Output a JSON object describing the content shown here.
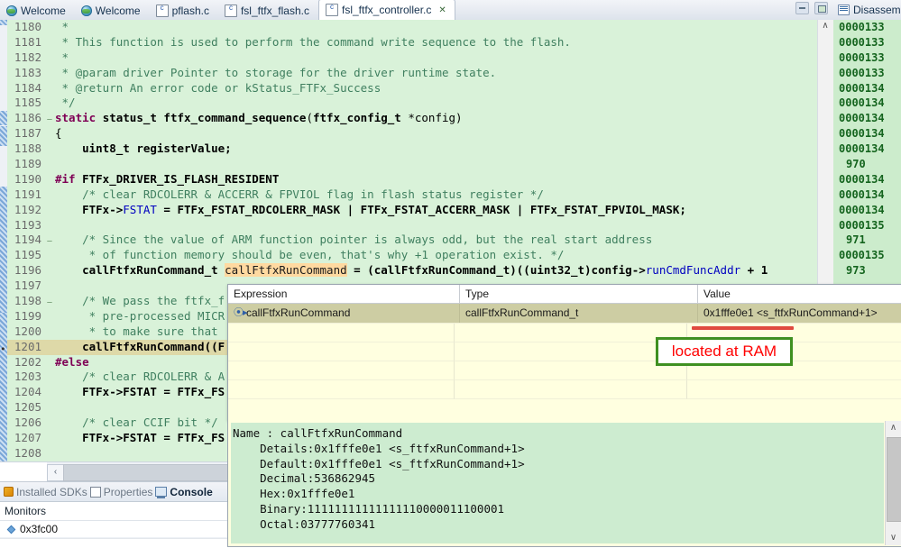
{
  "window": {
    "minimize_label": "minimize",
    "maximize_label": "maximize"
  },
  "editor_tabs": [
    {
      "label": "Welcome",
      "icon": "globe-icon",
      "active": false,
      "closeable": false
    },
    {
      "label": "Welcome",
      "icon": "globe-icon",
      "active": false,
      "closeable": false
    },
    {
      "label": "pflash.c",
      "icon": "c-file-icon",
      "active": false,
      "closeable": false
    },
    {
      "label": "fsl_ftfx_flash.c",
      "icon": "c-file-icon",
      "active": false,
      "closeable": false
    },
    {
      "label": "fsl_ftfx_controller.c",
      "icon": "c-file-icon",
      "active": true,
      "closeable": true,
      "close_glyph": "✕"
    }
  ],
  "code": {
    "lines": [
      {
        "n": "1180",
        "fold": "",
        "segs": [
          {
            "t": " *",
            "c": "cmt"
          }
        ]
      },
      {
        "n": "1181",
        "fold": "",
        "segs": [
          {
            "t": " * This function is used to perform the command write sequence to the flash.",
            "c": "cmt"
          }
        ]
      },
      {
        "n": "1182",
        "fold": "",
        "segs": [
          {
            "t": " *",
            "c": "cmt"
          }
        ]
      },
      {
        "n": "1183",
        "fold": "",
        "segs": [
          {
            "t": " * @param driver Pointer to storage for the driver runtime state.",
            "c": "cmt"
          }
        ]
      },
      {
        "n": "1184",
        "fold": "",
        "segs": [
          {
            "t": " * @return An error code or kStatus_FTFx_Success",
            "c": "cmt"
          }
        ]
      },
      {
        "n": "1185",
        "fold": "",
        "segs": [
          {
            "t": " */",
            "c": "cmt"
          }
        ]
      },
      {
        "n": "1186",
        "fold": "⊖",
        "segs": [
          {
            "t": "static ",
            "c": "kw"
          },
          {
            "t": "status_t ",
            "c": "typ"
          },
          {
            "t": "ftfx_command_sequence",
            "c": "fn"
          },
          {
            "t": "(",
            "c": "plain"
          },
          {
            "t": "ftfx_config_t ",
            "c": "typ"
          },
          {
            "t": "*config)",
            "c": "plain"
          }
        ]
      },
      {
        "n": "1187",
        "fold": "",
        "segs": [
          {
            "t": "{",
            "c": "plain"
          }
        ]
      },
      {
        "n": "1188",
        "fold": "",
        "segs": [
          {
            "t": "    uint8_t ",
            "c": "typ"
          },
          {
            "t": "registerValue;",
            "c": "typ"
          }
        ]
      },
      {
        "n": "1189",
        "fold": "",
        "segs": [
          {
            "t": "",
            "c": "plain"
          }
        ]
      },
      {
        "n": "1190",
        "fold": "",
        "segs": [
          {
            "t": "#if ",
            "c": "pre"
          },
          {
            "t": "FTFx_DRIVER_IS_FLASH_RESIDENT",
            "c": "typ"
          }
        ]
      },
      {
        "n": "1191",
        "fold": "",
        "segs": [
          {
            "t": "    /* clear RDCOLERR & ACCERR & FPVIOL flag in flash status register */",
            "c": "cmt"
          }
        ]
      },
      {
        "n": "1192",
        "fold": "",
        "segs": [
          {
            "t": "    FTFx->",
            "c": "typ"
          },
          {
            "t": "FSTAT",
            "c": "fld"
          },
          {
            "t": " = FTFx_FSTAT_RDCOLERR_MASK | FTFx_FSTAT_ACCERR_MASK | FTFx_FSTAT_FPVIOL_MASK;",
            "c": "typ"
          }
        ]
      },
      {
        "n": "1193",
        "fold": "",
        "segs": [
          {
            "t": "",
            "c": "plain"
          }
        ]
      },
      {
        "n": "1194",
        "fold": "⊖",
        "segs": [
          {
            "t": "    /* Since the value of ARM function pointer is always odd, but the real start address",
            "c": "cmt"
          }
        ]
      },
      {
        "n": "1195",
        "fold": "",
        "segs": [
          {
            "t": "     * of function memory should be even, that's why +1 operation exist. */",
            "c": "cmt"
          }
        ]
      },
      {
        "n": "1196",
        "fold": "",
        "segs": [
          {
            "t": "    callFtfxRunCommand_t ",
            "c": "typ"
          },
          {
            "t": "callFtfxRunCommand",
            "c": "hl"
          },
          {
            "t": " = (callFtfxRunCommand_t)((uint32_t)config->",
            "c": "typ"
          },
          {
            "t": "runCmdFuncAddr",
            "c": "fld"
          },
          {
            "t": " + 1",
            "c": "typ"
          }
        ]
      },
      {
        "n": "1197",
        "fold": "",
        "segs": [
          {
            "t": "",
            "c": "plain"
          }
        ]
      },
      {
        "n": "1198",
        "fold": "⊖",
        "segs": [
          {
            "t": "    /* We pass the ftfx_f",
            "c": "cmt"
          }
        ]
      },
      {
        "n": "1199",
        "fold": "",
        "segs": [
          {
            "t": "     * pre-processed MICR",
            "c": "cmt"
          }
        ]
      },
      {
        "n": "1200",
        "fold": "",
        "segs": [
          {
            "t": "     * to make sure that",
            "c": "cmt"
          }
        ]
      },
      {
        "n": "1201",
        "fold": "",
        "segs": [
          {
            "t": "    callFtfxRunCommand((F",
            "c": "typ"
          }
        ],
        "current": true,
        "marker": "•"
      },
      {
        "n": "1202",
        "fold": "",
        "segs": [
          {
            "t": "#else",
            "c": "pre"
          }
        ]
      },
      {
        "n": "1203",
        "fold": "",
        "segs": [
          {
            "t": "    /* clear RDCOLERR & A",
            "c": "cmt"
          }
        ]
      },
      {
        "n": "1204",
        "fold": "",
        "segs": [
          {
            "t": "    FTFx->FSTAT = FTFx_FS",
            "c": "typ"
          }
        ]
      },
      {
        "n": "1205",
        "fold": "",
        "segs": [
          {
            "t": "",
            "c": "plain"
          }
        ]
      },
      {
        "n": "1206",
        "fold": "",
        "segs": [
          {
            "t": "    /* clear CCIF bit */",
            "c": "cmt"
          }
        ]
      },
      {
        "n": "1207",
        "fold": "",
        "segs": [
          {
            "t": "    FTFx->FSTAT = FTFx_FS",
            "c": "typ"
          }
        ]
      },
      {
        "n": "1208",
        "fold": "",
        "segs": [
          {
            "t": "",
            "c": "plain"
          }
        ]
      }
    ],
    "hscroll_left_glyph": "‹",
    "vscroll_up_glyph": "∧"
  },
  "disassembly": {
    "tab_label": "Disassem",
    "icon": "disassembly-icon",
    "lines": [
      {
        "text": "0000133",
        "src": false
      },
      {
        "text": "0000133",
        "src": false
      },
      {
        "text": "0000133",
        "src": false
      },
      {
        "text": "0000133",
        "src": false
      },
      {
        "text": "0000134",
        "src": false
      },
      {
        "text": "0000134",
        "src": false
      },
      {
        "text": "0000134",
        "src": false
      },
      {
        "text": "0000134",
        "src": false
      },
      {
        "text": "0000134",
        "src": false
      },
      {
        "text": "970",
        "src": true
      },
      {
        "text": "0000134",
        "src": false
      },
      {
        "text": "0000134",
        "src": false
      },
      {
        "text": "0000134",
        "src": false
      },
      {
        "text": "0000135",
        "src": false
      },
      {
        "text": "971",
        "src": true
      },
      {
        "text": "0000135",
        "src": false
      },
      {
        "text": "973",
        "src": true
      }
    ]
  },
  "expressions": {
    "columns": [
      "Expression",
      "Type",
      "Value"
    ],
    "rows": [
      {
        "icon": "variable-icon",
        "icon_glyph": "⦿▸",
        "expression": "callFtfxRunCommand",
        "type": "callFtfxRunCommand_t",
        "value": "0x1fffe0e1 <s_ftfxRunCommand+1>",
        "selected": true
      }
    ],
    "empty_rows": 4
  },
  "annotation": {
    "text": "located at RAM",
    "box_border_color": "#3f9021",
    "text_color": "#ff0000",
    "underline_color": "#e04a3f"
  },
  "detail_pane": {
    "lines": [
      "Name : callFtfxRunCommand",
      "    Details:0x1fffe0e1 <s_ftfxRunCommand+1>",
      "    Default:0x1fffe0e1 <s_ftfxRunCommand+1>",
      "    Decimal:536862945",
      "    Hex:0x1fffe0e1",
      "    Binary:11111111111111110000011100001",
      "    Octal:03777760341"
    ],
    "scroll_up_glyph": "∧",
    "scroll_down_glyph": "∨"
  },
  "bottom_left": {
    "tabs": [
      {
        "label": "Installed SDKs",
        "icon": "sdk-icon",
        "active": false
      },
      {
        "label": "Properties",
        "icon": "properties-icon",
        "active": false
      },
      {
        "label": "Console",
        "icon": "console-icon",
        "active": true
      }
    ],
    "monitors_header": "Monitors",
    "monitors": [
      {
        "label": "0x3fc00"
      }
    ]
  },
  "colors": {
    "code_background": "#d9f2d9",
    "highlight": "#ffd9a0",
    "current_line": "#ded9a8",
    "expr_background": "#ffffe0",
    "selected_row": "#cdcda3",
    "detail_background": "#cdecd0",
    "disassembly_text": "#14641e"
  }
}
